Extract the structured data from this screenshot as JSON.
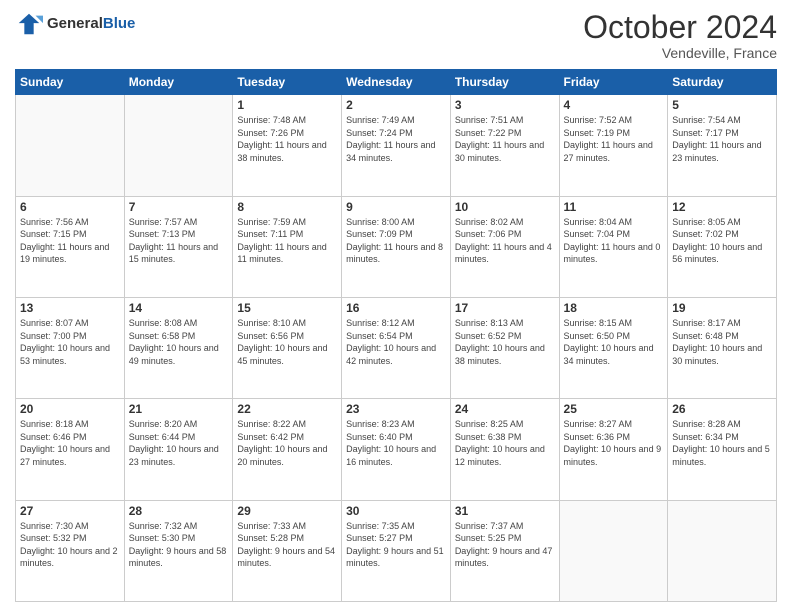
{
  "header": {
    "logo_general": "General",
    "logo_blue": "Blue",
    "month": "October 2024",
    "location": "Vendeville, France"
  },
  "weekdays": [
    "Sunday",
    "Monday",
    "Tuesday",
    "Wednesday",
    "Thursday",
    "Friday",
    "Saturday"
  ],
  "weeks": [
    [
      {
        "day": "",
        "sunrise": "",
        "sunset": "",
        "daylight": ""
      },
      {
        "day": "",
        "sunrise": "",
        "sunset": "",
        "daylight": ""
      },
      {
        "day": "1",
        "sunrise": "Sunrise: 7:48 AM",
        "sunset": "Sunset: 7:26 PM",
        "daylight": "Daylight: 11 hours and 38 minutes."
      },
      {
        "day": "2",
        "sunrise": "Sunrise: 7:49 AM",
        "sunset": "Sunset: 7:24 PM",
        "daylight": "Daylight: 11 hours and 34 minutes."
      },
      {
        "day": "3",
        "sunrise": "Sunrise: 7:51 AM",
        "sunset": "Sunset: 7:22 PM",
        "daylight": "Daylight: 11 hours and 30 minutes."
      },
      {
        "day": "4",
        "sunrise": "Sunrise: 7:52 AM",
        "sunset": "Sunset: 7:19 PM",
        "daylight": "Daylight: 11 hours and 27 minutes."
      },
      {
        "day": "5",
        "sunrise": "Sunrise: 7:54 AM",
        "sunset": "Sunset: 7:17 PM",
        "daylight": "Daylight: 11 hours and 23 minutes."
      }
    ],
    [
      {
        "day": "6",
        "sunrise": "Sunrise: 7:56 AM",
        "sunset": "Sunset: 7:15 PM",
        "daylight": "Daylight: 11 hours and 19 minutes."
      },
      {
        "day": "7",
        "sunrise": "Sunrise: 7:57 AM",
        "sunset": "Sunset: 7:13 PM",
        "daylight": "Daylight: 11 hours and 15 minutes."
      },
      {
        "day": "8",
        "sunrise": "Sunrise: 7:59 AM",
        "sunset": "Sunset: 7:11 PM",
        "daylight": "Daylight: 11 hours and 11 minutes."
      },
      {
        "day": "9",
        "sunrise": "Sunrise: 8:00 AM",
        "sunset": "Sunset: 7:09 PM",
        "daylight": "Daylight: 11 hours and 8 minutes."
      },
      {
        "day": "10",
        "sunrise": "Sunrise: 8:02 AM",
        "sunset": "Sunset: 7:06 PM",
        "daylight": "Daylight: 11 hours and 4 minutes."
      },
      {
        "day": "11",
        "sunrise": "Sunrise: 8:04 AM",
        "sunset": "Sunset: 7:04 PM",
        "daylight": "Daylight: 11 hours and 0 minutes."
      },
      {
        "day": "12",
        "sunrise": "Sunrise: 8:05 AM",
        "sunset": "Sunset: 7:02 PM",
        "daylight": "Daylight: 10 hours and 56 minutes."
      }
    ],
    [
      {
        "day": "13",
        "sunrise": "Sunrise: 8:07 AM",
        "sunset": "Sunset: 7:00 PM",
        "daylight": "Daylight: 10 hours and 53 minutes."
      },
      {
        "day": "14",
        "sunrise": "Sunrise: 8:08 AM",
        "sunset": "Sunset: 6:58 PM",
        "daylight": "Daylight: 10 hours and 49 minutes."
      },
      {
        "day": "15",
        "sunrise": "Sunrise: 8:10 AM",
        "sunset": "Sunset: 6:56 PM",
        "daylight": "Daylight: 10 hours and 45 minutes."
      },
      {
        "day": "16",
        "sunrise": "Sunrise: 8:12 AM",
        "sunset": "Sunset: 6:54 PM",
        "daylight": "Daylight: 10 hours and 42 minutes."
      },
      {
        "day": "17",
        "sunrise": "Sunrise: 8:13 AM",
        "sunset": "Sunset: 6:52 PM",
        "daylight": "Daylight: 10 hours and 38 minutes."
      },
      {
        "day": "18",
        "sunrise": "Sunrise: 8:15 AM",
        "sunset": "Sunset: 6:50 PM",
        "daylight": "Daylight: 10 hours and 34 minutes."
      },
      {
        "day": "19",
        "sunrise": "Sunrise: 8:17 AM",
        "sunset": "Sunset: 6:48 PM",
        "daylight": "Daylight: 10 hours and 30 minutes."
      }
    ],
    [
      {
        "day": "20",
        "sunrise": "Sunrise: 8:18 AM",
        "sunset": "Sunset: 6:46 PM",
        "daylight": "Daylight: 10 hours and 27 minutes."
      },
      {
        "day": "21",
        "sunrise": "Sunrise: 8:20 AM",
        "sunset": "Sunset: 6:44 PM",
        "daylight": "Daylight: 10 hours and 23 minutes."
      },
      {
        "day": "22",
        "sunrise": "Sunrise: 8:22 AM",
        "sunset": "Sunset: 6:42 PM",
        "daylight": "Daylight: 10 hours and 20 minutes."
      },
      {
        "day": "23",
        "sunrise": "Sunrise: 8:23 AM",
        "sunset": "Sunset: 6:40 PM",
        "daylight": "Daylight: 10 hours and 16 minutes."
      },
      {
        "day": "24",
        "sunrise": "Sunrise: 8:25 AM",
        "sunset": "Sunset: 6:38 PM",
        "daylight": "Daylight: 10 hours and 12 minutes."
      },
      {
        "day": "25",
        "sunrise": "Sunrise: 8:27 AM",
        "sunset": "Sunset: 6:36 PM",
        "daylight": "Daylight: 10 hours and 9 minutes."
      },
      {
        "day": "26",
        "sunrise": "Sunrise: 8:28 AM",
        "sunset": "Sunset: 6:34 PM",
        "daylight": "Daylight: 10 hours and 5 minutes."
      }
    ],
    [
      {
        "day": "27",
        "sunrise": "Sunrise: 7:30 AM",
        "sunset": "Sunset: 5:32 PM",
        "daylight": "Daylight: 10 hours and 2 minutes."
      },
      {
        "day": "28",
        "sunrise": "Sunrise: 7:32 AM",
        "sunset": "Sunset: 5:30 PM",
        "daylight": "Daylight: 9 hours and 58 minutes."
      },
      {
        "day": "29",
        "sunrise": "Sunrise: 7:33 AM",
        "sunset": "Sunset: 5:28 PM",
        "daylight": "Daylight: 9 hours and 54 minutes."
      },
      {
        "day": "30",
        "sunrise": "Sunrise: 7:35 AM",
        "sunset": "Sunset: 5:27 PM",
        "daylight": "Daylight: 9 hours and 51 minutes."
      },
      {
        "day": "31",
        "sunrise": "Sunrise: 7:37 AM",
        "sunset": "Sunset: 5:25 PM",
        "daylight": "Daylight: 9 hours and 47 minutes."
      },
      {
        "day": "",
        "sunrise": "",
        "sunset": "",
        "daylight": ""
      },
      {
        "day": "",
        "sunrise": "",
        "sunset": "",
        "daylight": ""
      }
    ]
  ]
}
